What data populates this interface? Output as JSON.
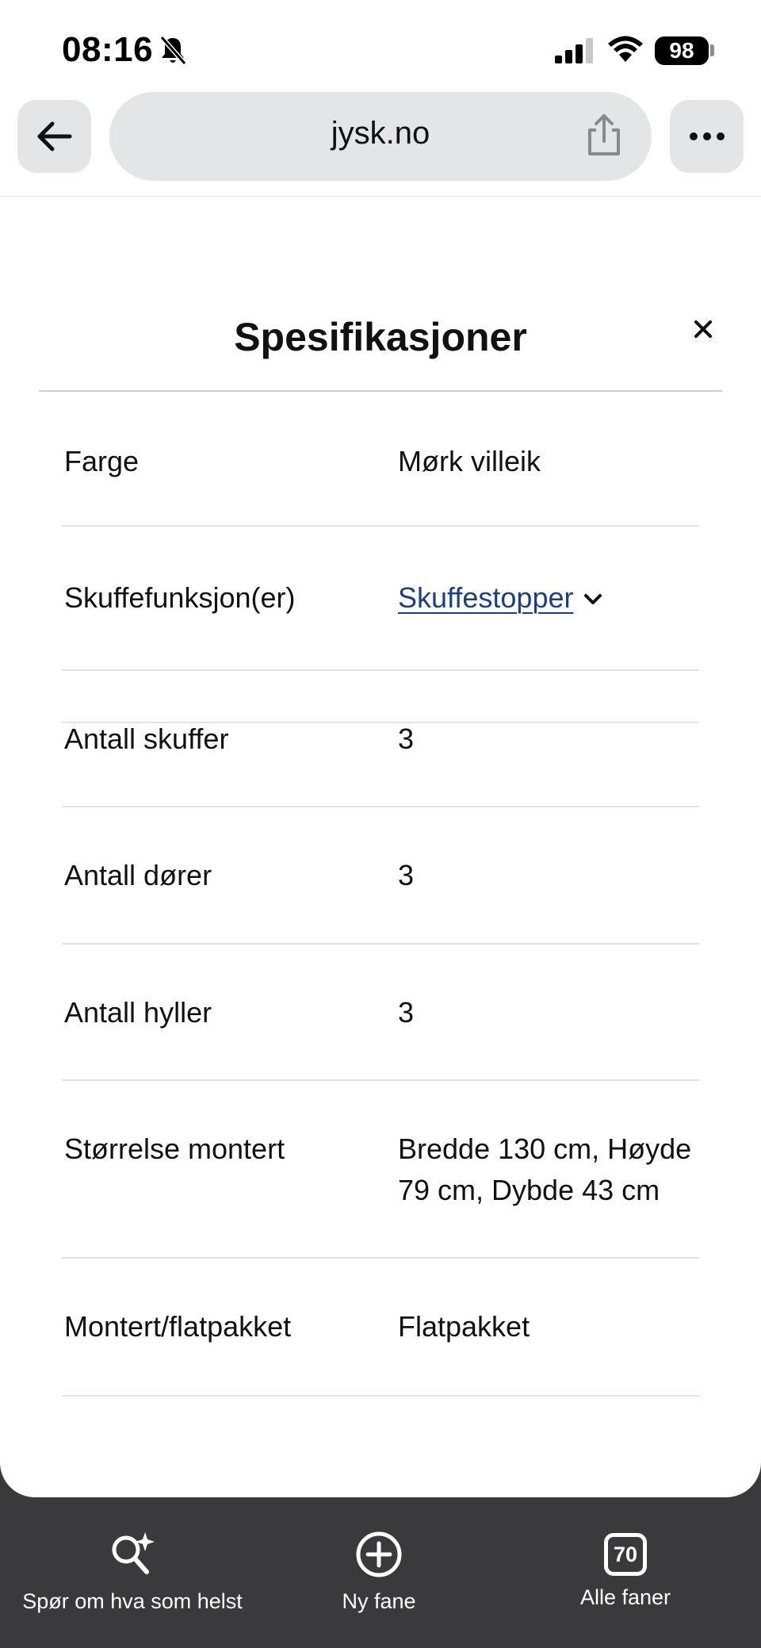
{
  "status_bar": {
    "time": "08:16",
    "battery": "98",
    "icons": [
      "bell-off-icon",
      "signal-icon",
      "wifi-icon",
      "battery-icon"
    ]
  },
  "browser": {
    "url": "jysk.no",
    "back_icon": "arrow-left-icon",
    "share_icon": "share-icon",
    "more_icon": "ellipsis-icon"
  },
  "sheet": {
    "title": "Spesifikasjoner",
    "close_icon": "close-icon",
    "specs": [
      {
        "label": "Farge",
        "value": "Mørk villeik"
      },
      {
        "label": "Skuffefunksjon(er)",
        "value": "Skuffestopper",
        "is_link": true
      },
      {
        "label": "Antall skuffer",
        "value": "3"
      },
      {
        "label": "Antall dører",
        "value": "3"
      },
      {
        "label": "Antall hyller",
        "value": "3"
      },
      {
        "label": "Størrelse montert",
        "value": "Bredde 130 cm, Høyde 79 cm, Dybde 43 cm"
      },
      {
        "label": "Montert/flatpakket",
        "value": "Flatpakket"
      }
    ]
  },
  "toolbar": {
    "ask_label": "Spør om hva som helst",
    "new_tab_label": "Ny fane",
    "all_tabs_label": "Alle faner",
    "tab_count": "70"
  },
  "colors": {
    "link": "#1f3f7a",
    "toolbar_bg": "#3a3a3c",
    "pill_bg": "#e4e5e7"
  }
}
